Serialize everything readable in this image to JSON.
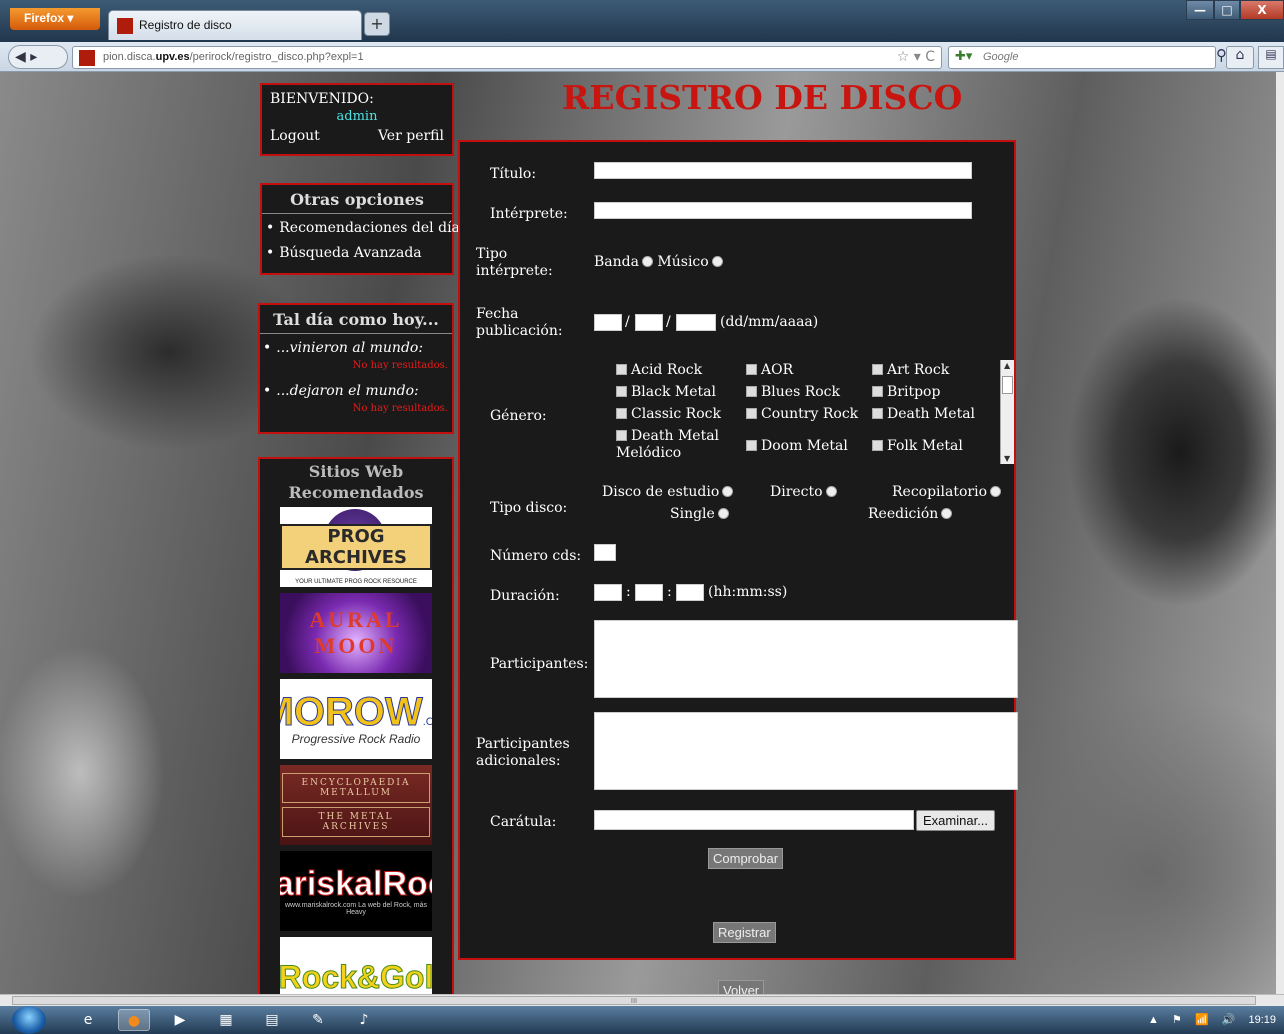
{
  "browser": {
    "app_button": "Firefox ▾",
    "tab_title": "Registro de disco",
    "new_tab": "+",
    "url_prefix": "pion.disca.",
    "url_host": "upv.es",
    "url_path": "/perirock/registro_disco.php?expl=1",
    "search_engine_icon": "google-icon",
    "search_placeholder": "Google",
    "controls": {
      "minimize": "—",
      "maximize": "□",
      "close": "X"
    }
  },
  "welcome": {
    "greeting": "BIENVENIDO:",
    "user": "admin",
    "logout": "Logout",
    "profile": "Ver perfil"
  },
  "other_options": {
    "title": "Otras opciones",
    "items": [
      "Recomendaciones del día",
      "Búsqueda Avanzada"
    ]
  },
  "today": {
    "title": "Tal día como hoy...",
    "born_label": "...vinieron al mundo:",
    "born_result": "No hay resultados.",
    "died_label": "...dejaron el mundo:",
    "died_result": "No hay resultados."
  },
  "sites": {
    "title": "Sitios Web Recomendados",
    "banners": {
      "prog": {
        "text": "PROG ARCHIVES",
        "sub": "YOUR ULTIMATE PROG ROCK RESOURCE"
      },
      "aural": {
        "text": "AURAL MOON"
      },
      "morow": {
        "text": "MOROW",
        "suffix": ".COM",
        "sub": "Progressive Rock Radio"
      },
      "metal": {
        "text": "ENCYCLOPAEDIA METALLUM",
        "sub": "THE METAL ARCHIVES"
      },
      "marisk": {
        "text": "MariskalRock",
        "sub": "www.mariskalrock.com La web del Rock, más Heavy"
      },
      "rock": {
        "text": "Rock&Gol"
      }
    }
  },
  "page": {
    "title": "REGISTRO DE DISCO"
  },
  "form": {
    "titulo_label": "Título:",
    "interprete_label": "Intérprete:",
    "tipo_interprete_label": "Tipo intérprete:",
    "tipo_interprete_options": [
      "Banda",
      "Músico"
    ],
    "fecha_label": "Fecha publicación:",
    "date_sep": "/",
    "date_hint": "(dd/mm/aaaa)",
    "genero_label": "Género:",
    "genres": [
      "Acid Rock",
      "AOR",
      "Art Rock",
      "Black Metal",
      "Blues Rock",
      "Britpop",
      "Classic Rock",
      "Country Rock",
      "Death Metal",
      "Death Metal Melódico",
      "Doom Metal",
      "Folk Metal"
    ],
    "tipo_disco_label": "Tipo disco:",
    "tipo_disco_options": [
      "Disco de estudio",
      "Directo",
      "Recopilatorio",
      "Single",
      "Reedición"
    ],
    "numero_cds_label": "Número cds:",
    "duracion_label": "Duración:",
    "time_sep": ":",
    "duracion_hint": "(hh:mm:ss)",
    "participantes_label": "Participantes:",
    "participantes_adicionales_label": "Participantes adicionales:",
    "caratula_label": "Carátula:",
    "examinar": "Examinar...",
    "comprobar": "Comprobar",
    "registrar": "Registrar",
    "volver": "Volver"
  },
  "taskbar": {
    "clock": "19:19",
    "tray_icons": [
      "▲",
      "⚑",
      "📶",
      "🔊"
    ]
  }
}
